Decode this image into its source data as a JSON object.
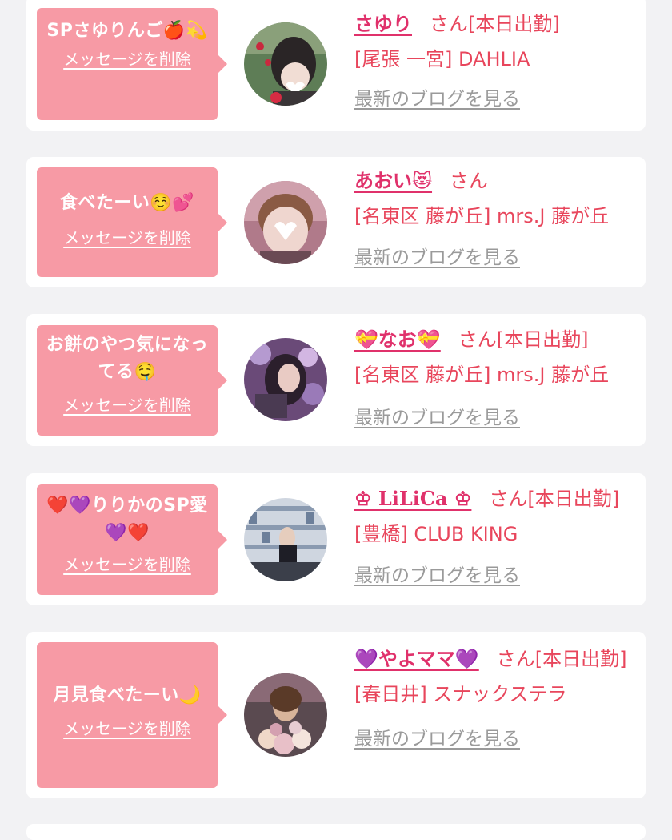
{
  "colors": {
    "background": "#f2f2f4",
    "bubble": "#f79aa5",
    "name": "#e0316b",
    "shop": "#e8465c",
    "blog_link": "#9a9a9a"
  },
  "entries": [
    {
      "message": "SPさゆりんご🍎💫",
      "delete_label": "メッセージを削除",
      "name": "さゆり",
      "suffix": "さん[本日出勤]",
      "shop": "[尾張 一宮] DAHLIA",
      "blog_label": "最新のブログを見る",
      "avatar_icon": "profile-photo-strawberry-icon"
    },
    {
      "message": "食べたーい☺️💕",
      "delete_label": "メッセージを削除",
      "name": "あおい😻",
      "suffix": "さん",
      "shop": "[名東区 藤が丘] mrs.J 藤が丘",
      "blog_label": "最新のブログを見る",
      "avatar_icon": "profile-photo-heart-icon"
    },
    {
      "message": "お餅のやつ気になってる🤤",
      "delete_label": "メッセージを削除",
      "name": "💝なお💝",
      "suffix": "さん[本日出勤]",
      "shop": "[名東区 藤が丘] mrs.J 藤が丘",
      "blog_label": "最新のブログを見る",
      "avatar_icon": "profile-photo-flowers-icon"
    },
    {
      "message": "❤️💜りりかのSP愛💜❤️",
      "delete_label": "メッセージを削除",
      "name": "♔ LiLiCa ♔",
      "suffix": "さん[本日出勤]",
      "shop": "[豊橋] CLUB KING",
      "blog_label": "最新のブログを見る",
      "avatar_icon": "profile-photo-club-icon"
    },
    {
      "message": "月見食べたーい🌙",
      "delete_label": "メッセージを削除",
      "name": "💜やよママ💜",
      "suffix": "さん[本日出勤]",
      "shop": "[春日井] スナックステラ",
      "blog_label": "最新のブログを見る",
      "avatar_icon": "profile-photo-bouquet-icon"
    }
  ]
}
